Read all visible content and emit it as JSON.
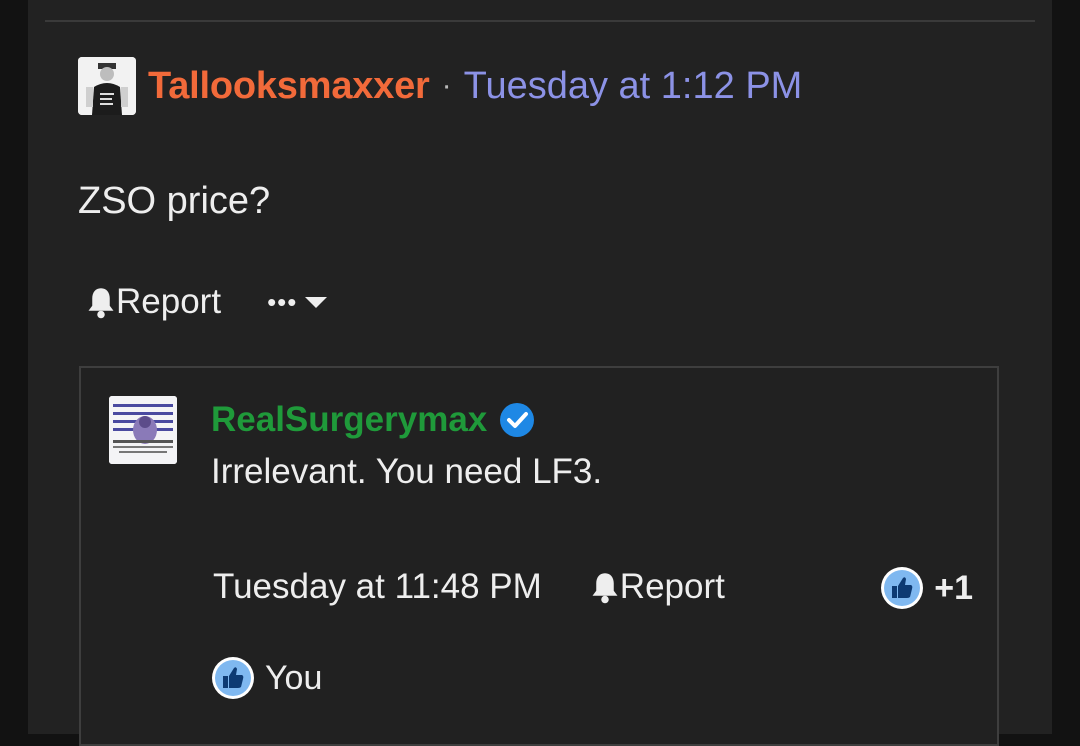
{
  "post": {
    "username": "Tallooksmaxxer",
    "separator": "·",
    "timestamp": "Tuesday at 1:12 PM",
    "body": "ZSO price?",
    "report_label": "Report",
    "more_label": "•••"
  },
  "reply": {
    "username": "RealSurgerymax",
    "text": "Irrelevant. You need LF3.",
    "timestamp": "Tuesday at 11:48 PM",
    "report_label": "Report",
    "reaction_count": "+1",
    "reacted_by": "You"
  },
  "colors": {
    "post_username": "#f26a3a",
    "post_time": "#8c92e6",
    "reply_username": "#1f9a3a",
    "verified_badge": "#1e88e5",
    "like_badge": "#7fb8f0"
  },
  "icons": {
    "report": "bell-icon",
    "more": "chevron-down-icon",
    "verified": "verified-check-icon",
    "reaction": "thumbs-up-icon"
  }
}
